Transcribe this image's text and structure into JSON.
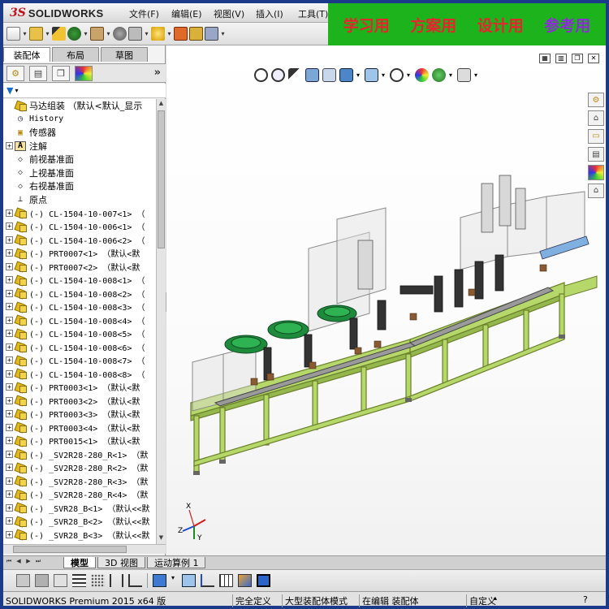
{
  "app": {
    "logo_ds": "3S",
    "logo_name": "SOLIDWORKS"
  },
  "menu": [
    "文件(F)",
    "编辑(E)",
    "视图(V)",
    "插入(I)",
    "工具(T)"
  ],
  "banner": {
    "items": [
      "学习用",
      "方案用",
      "设计用",
      "参考用"
    ],
    "colors": [
      "#e8232e",
      "#e8232e",
      "#e8232e",
      "#8e2bd6"
    ],
    "background": "#1db31d"
  },
  "panel": {
    "tabs": [
      "装配体",
      "布局",
      "草图"
    ],
    "active_tab": "装配体",
    "expander": "»",
    "filter_icon": "filter-icon"
  },
  "tree": {
    "root": "马达组装 （默认<默认_显示",
    "items": [
      {
        "pm": "",
        "icon": "history-icon",
        "label": "History",
        "mono": true
      },
      {
        "pm": "",
        "icon": "sensor-icon",
        "label": "传感器",
        "mono": false
      },
      {
        "pm": "+",
        "icon": "annotation-icon",
        "label": "注解",
        "mono": false
      },
      {
        "pm": "",
        "icon": "plane-icon",
        "label": "前视基准面",
        "mono": false
      },
      {
        "pm": "",
        "icon": "plane-icon",
        "label": "上视基准面",
        "mono": false
      },
      {
        "pm": "",
        "icon": "plane-icon",
        "label": "右视基准面",
        "mono": false
      },
      {
        "pm": "",
        "icon": "origin-icon",
        "label": "原点",
        "mono": false
      },
      {
        "pm": "+",
        "icon": "part-icon",
        "label": "(-) CL-1504-10-007<1> （",
        "mono": true
      },
      {
        "pm": "+",
        "icon": "part-icon",
        "label": "(-) CL-1504-10-006<1> （",
        "mono": true
      },
      {
        "pm": "+",
        "icon": "part-icon",
        "label": "(-) CL-1504-10-006<2> （",
        "mono": true
      },
      {
        "pm": "+",
        "icon": "part-icon",
        "label": "(-) PRT0007<1> （默认<默",
        "mono": true
      },
      {
        "pm": "+",
        "icon": "part-icon",
        "label": "(-) PRT0007<2> （默认<默",
        "mono": true
      },
      {
        "pm": "+",
        "icon": "part-icon",
        "label": "(-) CL-1504-10-008<1> （",
        "mono": true
      },
      {
        "pm": "+",
        "icon": "part-icon",
        "label": "(-) CL-1504-10-008<2> （",
        "mono": true
      },
      {
        "pm": "+",
        "icon": "part-icon",
        "label": "(-) CL-1504-10-008<3> （",
        "mono": true
      },
      {
        "pm": "+",
        "icon": "part-icon",
        "label": "(-) CL-1504-10-008<4> （",
        "mono": true
      },
      {
        "pm": "+",
        "icon": "part-icon",
        "label": "(-) CL-1504-10-008<5> （",
        "mono": true
      },
      {
        "pm": "+",
        "icon": "part-icon",
        "label": "(-) CL-1504-10-008<6> （",
        "mono": true
      },
      {
        "pm": "+",
        "icon": "part-icon",
        "label": "(-) CL-1504-10-008<7> （",
        "mono": true
      },
      {
        "pm": "+",
        "icon": "part-icon",
        "label": "(-) CL-1504-10-008<8> （",
        "mono": true
      },
      {
        "pm": "+",
        "icon": "part-icon",
        "label": "(-) PRT0003<1> （默认<默",
        "mono": true
      },
      {
        "pm": "+",
        "icon": "part-icon",
        "label": "(-) PRT0003<2> （默认<默",
        "mono": true
      },
      {
        "pm": "+",
        "icon": "part-icon",
        "label": "(-) PRT0003<3> （默认<默",
        "mono": true
      },
      {
        "pm": "+",
        "icon": "part-icon",
        "label": "(-) PRT0003<4> （默认<默",
        "mono": true
      },
      {
        "pm": "+",
        "icon": "part-icon",
        "label": "(-) PRT0015<1> （默认<默",
        "mono": true
      },
      {
        "pm": "+",
        "icon": "part-icon",
        "label": "(-) _SV2R28-280_R<1> （默",
        "mono": true
      },
      {
        "pm": "+",
        "icon": "part-icon",
        "label": "(-) _SV2R28-280_R<2> （默",
        "mono": true
      },
      {
        "pm": "+",
        "icon": "part-icon",
        "label": "(-) _SV2R28-280_R<3> （默",
        "mono": true
      },
      {
        "pm": "+",
        "icon": "part-icon",
        "label": "(-) _SV2R28-280_R<4> （默",
        "mono": true
      },
      {
        "pm": "+",
        "icon": "part-icon",
        "label": "(-) _SVR28_B<1> （默认<<默",
        "mono": true
      },
      {
        "pm": "+",
        "icon": "part-icon",
        "label": "(-) _SVR28_B<2> （默认<<默",
        "mono": true
      },
      {
        "pm": "+",
        "icon": "part-icon",
        "label": "(-) _SVR28_B<3> （默认<<默",
        "mono": true
      }
    ]
  },
  "bottom_tabs": [
    "模型",
    "3D 视图",
    "运动算例 1"
  ],
  "active_bottom_tab": "模型",
  "status": {
    "version": "SOLIDWORKS Premium 2015 x64 版",
    "defined": "完全定义",
    "mode": "大型装配体模式",
    "editing": "在编辑 装配体",
    "custom": "自定义"
  },
  "colors": {
    "frame": "#1b3a8a",
    "frame_green": "#b6d86a",
    "part_gold": "#e2b91c",
    "feeder_green": "#1e8a3c"
  }
}
